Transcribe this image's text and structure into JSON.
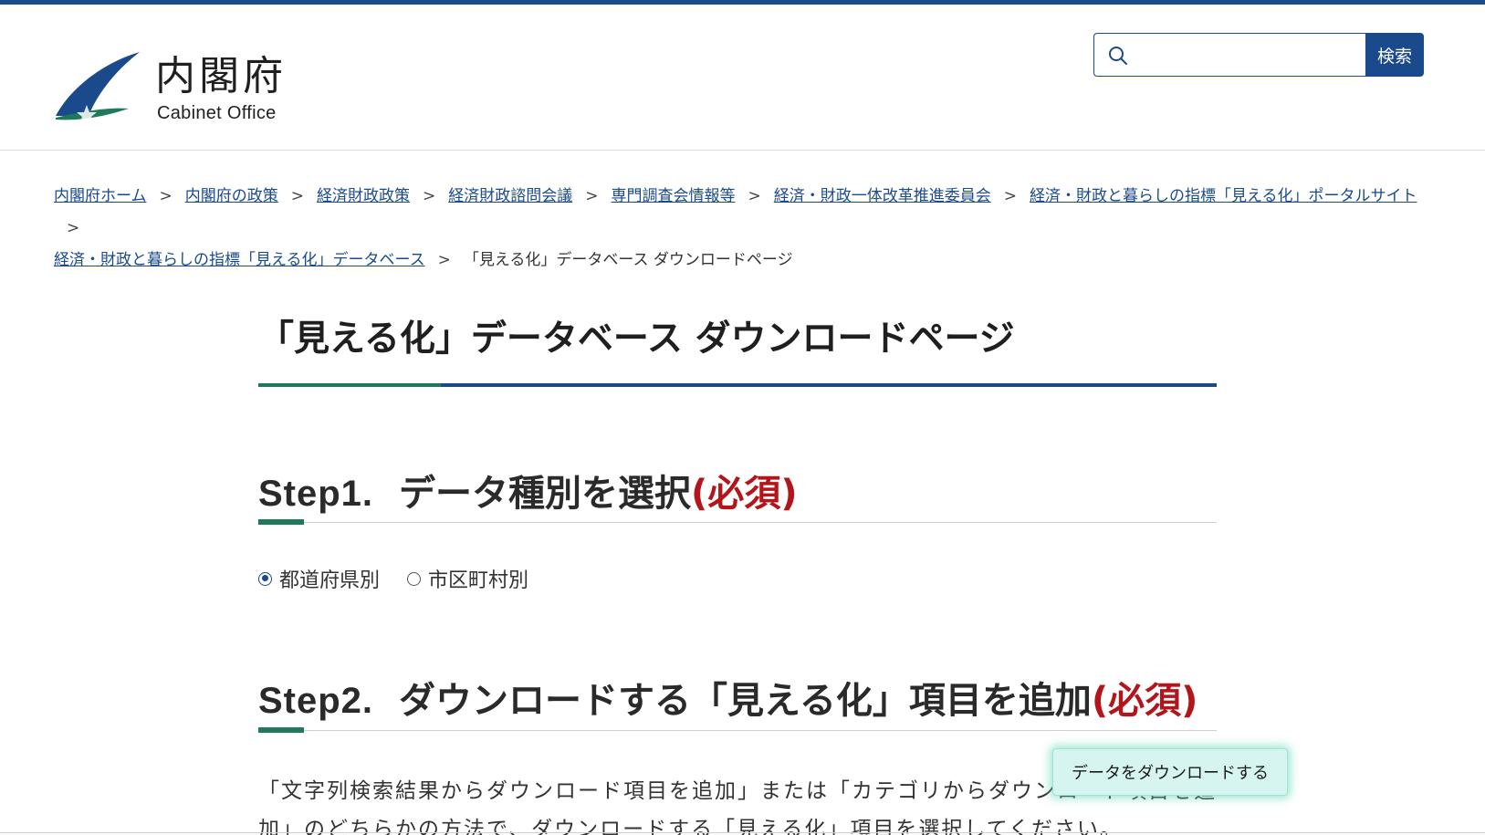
{
  "header": {
    "logo_ja": "内閣府",
    "logo_en": "Cabinet Office",
    "search_placeholder": "",
    "search_button": "検索"
  },
  "breadcrumb": {
    "items": [
      "内閣府ホーム",
      "内閣府の政策",
      "経済財政政策",
      "経済財政諮問会議",
      "専門調査会情報等",
      "経済・財政一体改革推進委員会",
      "経済・財政と暮らしの指標「見える化」ポータルサイト",
      "経済・財政と暮らしの指標「見える化」データベース"
    ],
    "separator": ">",
    "current": "「見える化」データベース ダウンロードページ"
  },
  "page_title": "「見える化」データベース ダウンロードページ",
  "step1": {
    "number": "Step1.",
    "title": "データ種別を選択",
    "required": "(必須)",
    "options": [
      {
        "label": "都道府県別",
        "selected": true
      },
      {
        "label": "市区町村別",
        "selected": false
      }
    ]
  },
  "step2": {
    "number": "Step2.",
    "title": "ダウンロードする「見える化」項目を追加",
    "required": "(必須)",
    "description_line1": "「文字列検索結果からダウンロード項目を追加」または「カテゴリからダウンロード項目を追",
    "description_line2": "加」のどちらかの方法で、ダウンロードする「見える化」項目を選択してください。"
  },
  "download_button": "データをダウンロードする",
  "colors": {
    "brand_blue": "#1b4a8c",
    "accent_green": "#1f7a5a",
    "required_red": "#b3151b",
    "download_bg": "#d6f5f0"
  }
}
